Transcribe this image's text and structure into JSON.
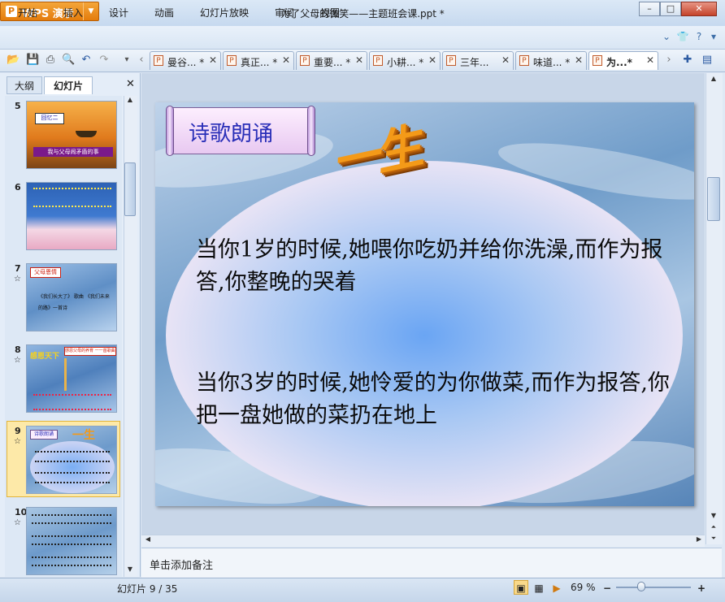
{
  "app": {
    "name": "WPS 演示",
    "document_title": "为了父母的微笑——主题班会课.ppt *"
  },
  "window_controls": {
    "minimize": "–",
    "maximize": "□",
    "close": "✕"
  },
  "menu": {
    "items": [
      "开始",
      "插入",
      "设计",
      "动画",
      "幻灯片放映",
      "审阅",
      "视图"
    ]
  },
  "doc_tabs": [
    {
      "label": "曼谷... *",
      "active": false
    },
    {
      "label": "真正... *",
      "active": false
    },
    {
      "label": "重要... *",
      "active": false
    },
    {
      "label": "小耕... *",
      "active": false
    },
    {
      "label": "三年...",
      "active": false
    },
    {
      "label": "味道... *",
      "active": false
    },
    {
      "label": "为...*",
      "active": true
    }
  ],
  "left_panel": {
    "tabs": [
      "大纲",
      "幻灯片"
    ],
    "close": "✕",
    "thumbnails": [
      {
        "number": "5",
        "star": false,
        "title": "回忆二",
        "caption": "我与父母闹矛盾的事"
      },
      {
        "number": "6",
        "star": false,
        "title": "",
        "caption": ""
      },
      {
        "number": "7",
        "star": true,
        "title": "父母恩情",
        "caption": "《我们长大了》 歌曲 《我们未来的路》一首诗"
      },
      {
        "number": "8",
        "star": true,
        "title": "感恩天下",
        "caption": "感恩父母的养育 一一首歌曲"
      },
      {
        "number": "9",
        "star": true,
        "title": "诗歌朗诵",
        "caption": "一生",
        "selected": true
      },
      {
        "number": "10",
        "star": true,
        "title": "",
        "caption": ""
      }
    ]
  },
  "slide": {
    "banner": "诗歌朗诵",
    "wordart": "一生",
    "paragraphs": [
      "当你1岁的时候,她喂你吃奶并给你洗澡,而作为报答,你整晚的哭着",
      "当你3岁的时候,她怜爱的为你做菜,而作为报答,你把一盘她做的菜扔在地上"
    ]
  },
  "notes_placeholder": "单击添加备注",
  "status": {
    "slide_counter": "幻灯片 9 / 35",
    "zoom": "69 %"
  },
  "colors": {
    "accent_orange": "#e47c0c",
    "banner_text": "#2a2fb8",
    "wordart": "#f49a18"
  }
}
